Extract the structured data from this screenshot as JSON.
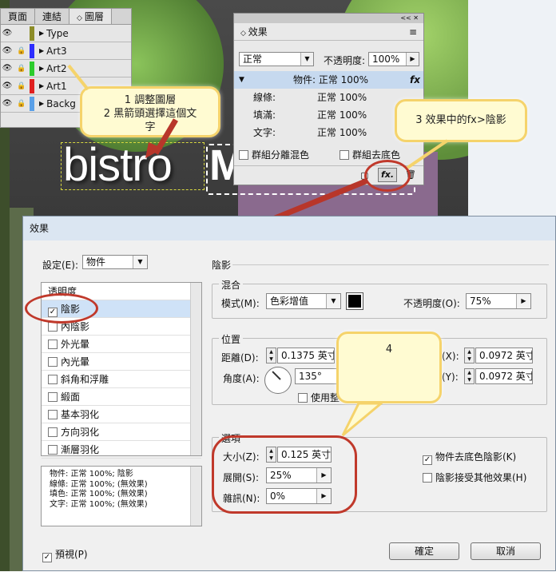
{
  "layers_panel": {
    "tabs": [
      "頁面",
      "連結",
      "圖層"
    ],
    "active_tab": "圖層",
    "layers": [
      {
        "name": "Type",
        "color": "#8c8c28",
        "locked": false
      },
      {
        "name": "Art3",
        "color": "#2d2dff",
        "locked": true
      },
      {
        "name": "Art2",
        "color": "#2dcc2d",
        "locked": true
      },
      {
        "name": "Art1",
        "color": "#e02020",
        "locked": true
      },
      {
        "name": "Backg",
        "color": "#5aa0e8",
        "locked": true
      }
    ]
  },
  "canvas_text": {
    "bistro": "bistro"
  },
  "effects_panel": {
    "title": "效果",
    "blend_mode": "正常",
    "opacity_label": "不透明度:",
    "opacity_value": "100%",
    "object_row": "物件: 正常 100%",
    "fx_label": "fx",
    "rows": [
      {
        "label": "線條:",
        "value": "正常 100%"
      },
      {
        "label": "填滿:",
        "value": "正常 100%"
      },
      {
        "label": "文字:",
        "value": "正常 100%"
      }
    ],
    "isolate_blending": "群組分離混色",
    "knockout_group": "群組去底色",
    "fx_button": "fx."
  },
  "callouts": {
    "c1_line1": "1 調整圖層",
    "c1_line2": "2 黑箭頭選擇這個文",
    "c1_line3": "字",
    "c3": "3 效果中的fx>陰影",
    "c4": "4"
  },
  "dialog": {
    "title": "效果",
    "settings_label": "設定(E):",
    "settings_value": "物件",
    "section_title": "陰影",
    "effects": [
      {
        "label": "透明度",
        "checked": false
      },
      {
        "label": "陰影",
        "checked": true
      },
      {
        "label": "內陰影",
        "checked": false
      },
      {
        "label": "外光暈",
        "checked": false
      },
      {
        "label": "內光暈",
        "checked": false
      },
      {
        "label": "斜角和浮雕",
        "checked": false
      },
      {
        "label": "緞面",
        "checked": false
      },
      {
        "label": "基本羽化",
        "checked": false
      },
      {
        "label": "方向羽化",
        "checked": false
      },
      {
        "label": "漸層羽化",
        "checked": false
      }
    ],
    "summary": [
      "物件: 正常 100%; 陰影",
      "線條: 正常 100%; (無效果)",
      "填色: 正常 100%; (無效果)",
      "文字: 正常 100%; (無效果)"
    ],
    "blend": {
      "title": "混合",
      "mode_label": "模式(M):",
      "mode_value": "色彩增值",
      "opacity_label": "不透明度(O):",
      "opacity_value": "75%",
      "color": "#000000"
    },
    "position": {
      "title": "位置",
      "distance_label": "距離(D):",
      "distance_value": "0.1375 英寸",
      "angle_label": "角度(A):",
      "angle_value": "135°",
      "use_global": "使用整",
      "x_label": "(X):",
      "x_value": "0.0972 英寸",
      "y_label": "(Y):",
      "y_value": "0.0972 英寸"
    },
    "options": {
      "title": "選項",
      "size_label": "大小(Z):",
      "size_value": "0.125 英寸",
      "spread_label": "展開(S):",
      "spread_value": "25%",
      "noise_label": "雜訊(N):",
      "noise_value": "0%",
      "knockout": "物件去底色陰影(K)",
      "honors_other": "陰影接受其他效果(H)"
    },
    "preview": "預視(P)",
    "ok": "確定",
    "cancel": "取消"
  }
}
